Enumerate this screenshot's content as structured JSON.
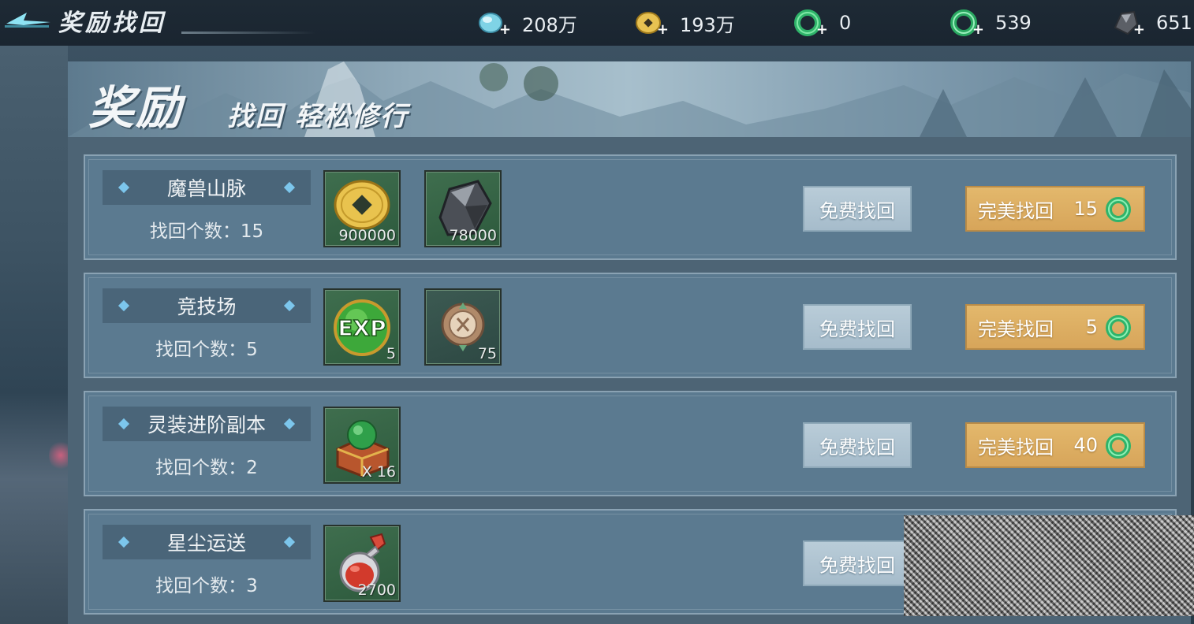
{
  "header": {
    "title": "奖励找回",
    "currencies": [
      {
        "icon": "spirit-stone-icon",
        "value": "208万"
      },
      {
        "icon": "gold-coin-icon",
        "value": "193万"
      },
      {
        "icon": "jade-ring-icon",
        "value": "0"
      },
      {
        "icon": "bound-jade-ring-icon",
        "value": "539"
      },
      {
        "icon": "ore-icon",
        "value": "651"
      }
    ]
  },
  "banner": {
    "big": "奖励",
    "small": "找回 轻松修行"
  },
  "rows": [
    {
      "title": "魔兽山脉",
      "count": "找回个数：15",
      "rewards": [
        {
          "icon": "gold-coin-icon",
          "qty": "900000"
        },
        {
          "icon": "dark-ore-icon",
          "qty": "78000"
        }
      ],
      "free_label": "免费找回",
      "perfect_label": "完美找回",
      "perfect_cost": "15"
    },
    {
      "title": "竞技场",
      "count": "找回个数：5",
      "rewards": [
        {
          "icon": "exp-orb-icon",
          "qty": "5"
        },
        {
          "icon": "arena-medal-icon",
          "qty": "75"
        }
      ],
      "free_label": "免费找回",
      "perfect_label": "完美找回",
      "perfect_cost": "5"
    },
    {
      "title": "灵装进阶副本",
      "count": "找回个数：2",
      "rewards": [
        {
          "icon": "treasure-chest-icon",
          "qty": "X 16"
        }
      ],
      "free_label": "免费找回",
      "perfect_label": "完美找回",
      "perfect_cost": "40"
    },
    {
      "title": "星尘运送",
      "count": "找回个数：3",
      "rewards": [
        {
          "icon": "potion-bottle-icon",
          "qty": "2700"
        }
      ],
      "free_label": "免费找回"
    }
  ]
}
